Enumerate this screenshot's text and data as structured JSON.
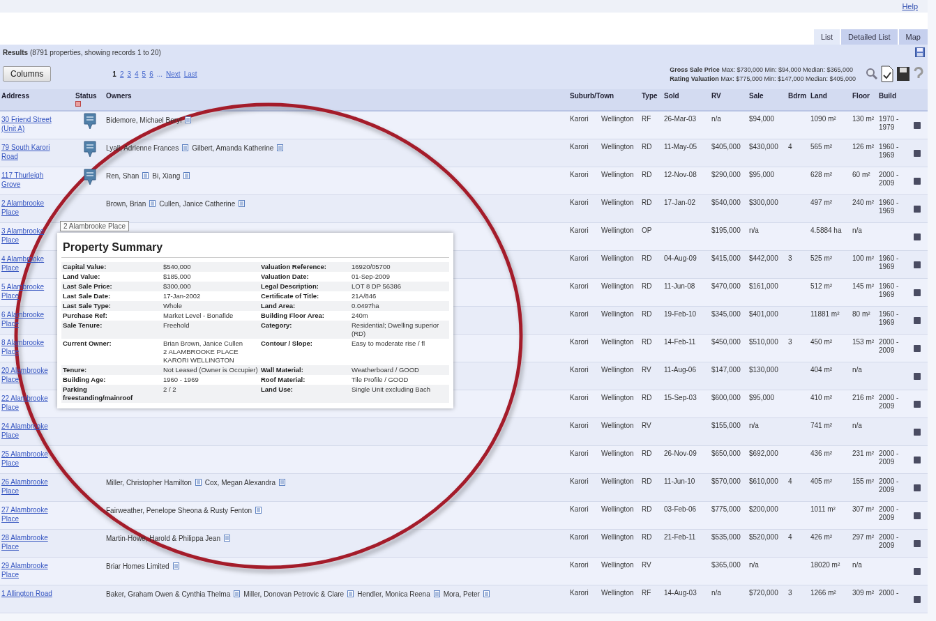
{
  "help_link": "Help",
  "tabs": [
    {
      "label": "List",
      "selected": true
    },
    {
      "label": "Detailed List",
      "selected": false
    },
    {
      "label": "Map",
      "selected": false
    }
  ],
  "results": {
    "title": "Results",
    "summary": "(8791 properties, showing records 1 to 20)"
  },
  "columns_button": "Columns",
  "pagination": {
    "pages": [
      {
        "label": "1",
        "selected": true
      },
      {
        "label": "2",
        "selected": false
      },
      {
        "label": "3",
        "selected": false
      },
      {
        "label": "4",
        "selected": false
      },
      {
        "label": "5",
        "selected": false
      },
      {
        "label": "6",
        "selected": false
      }
    ],
    "ellipsis": "...",
    "next": "Next",
    "last": "Last"
  },
  "stats": [
    {
      "label": "Gross Sale Price",
      "text": "Max: $730,000 Min: $94,000 Median: $365,000"
    },
    {
      "label": "Rating Valuation",
      "text": "Max: $775,000 Min: $147,000 Median: $405,000"
    }
  ],
  "table": {
    "columns": [
      "Address",
      "Status",
      "Owners",
      "Suburb/Town",
      "Type",
      "Sold",
      "RV",
      "Sale",
      "Bdrm",
      "Land",
      "Floor",
      "Build"
    ],
    "rows": [
      {
        "address": "30 Friend Street (Unit A)",
        "status": true,
        "owners": [
          "Bidemore, Michael Beryl"
        ],
        "suburb": "Karori",
        "town": "Wellington",
        "type": "RF",
        "sold": "26-Mar-03",
        "rv": "n/a",
        "sale": "$94,000",
        "land": "1090 m²",
        "floor": "130 m²",
        "build": "1970 - 1979"
      },
      {
        "address": "79 South Karori Road",
        "status": true,
        "owners": [
          "Lyall, Adrienne Frances",
          "Gilbert, Amanda Katherine"
        ],
        "suburb": "Karori",
        "town": "Wellington",
        "type": "RD",
        "sold": "11-May-05",
        "rv": "$405,000",
        "sale": "$430,000",
        "bdrm": "4",
        "land": "565 m²",
        "floor": "126 m²",
        "build": "1960 - 1969"
      },
      {
        "address": "117 Thurleigh Grove",
        "status": true,
        "owners": [
          "Ren, Shan",
          "Bi, Xiang"
        ],
        "suburb": "Karori",
        "town": "Wellington",
        "type": "RD",
        "sold": "12-Nov-08",
        "rv": "$290,000",
        "sale": "$95,000",
        "land": "628 m²",
        "floor": "60 m²",
        "build": "2000 - 2009"
      },
      {
        "address": "2 Alambrooke Place",
        "status": false,
        "owners": [
          "Brown, Brian",
          "Cullen, Janice Catherine"
        ],
        "suburb": "Karori",
        "town": "Wellington",
        "type": "RD",
        "sold": "17-Jan-02",
        "rv": "$540,000",
        "sale": "$300,000",
        "land": "497 m²",
        "floor": "240 m²",
        "build": "1960 - 1969"
      },
      {
        "address": "3 Alambrooke Place",
        "suburb": "Karori",
        "town": "Wellington",
        "type": "OP",
        "rv": "$195,000",
        "sale": "n/a",
        "land": "4.5884 ha",
        "floor": "n/a"
      },
      {
        "address": "4 Alambrooke Place",
        "suburb": "Karori",
        "town": "Wellington",
        "type": "RD",
        "sold": "04-Aug-09",
        "rv": "$415,000",
        "sale": "$442,000",
        "bdrm": "3",
        "land": "525 m²",
        "floor": "100 m²",
        "build": "1960 - 1969"
      },
      {
        "address": "5 Alambrooke Place",
        "suburb": "Karori",
        "town": "Wellington",
        "type": "RD",
        "sold": "11-Jun-08",
        "rv": "$470,000",
        "sale": "$161,000",
        "land": "512 m²",
        "floor": "145 m²",
        "build": "1960 - 1969"
      },
      {
        "address": "6 Alambrooke Place",
        "suburb": "Karori",
        "town": "Wellington",
        "type": "RD",
        "sold": "19-Feb-10",
        "rv": "$345,000",
        "sale": "$401,000",
        "land": "11881 m²",
        "floor": "80 m²",
        "build": "1960 - 1969"
      },
      {
        "address": "8 Alambrooke Place",
        "suburb": "Karori",
        "town": "Wellington",
        "type": "RD",
        "sold": "14-Feb-11",
        "rv": "$450,000",
        "sale": "$510,000",
        "bdrm": "3",
        "land": "450 m²",
        "floor": "153 m²",
        "build": "2000 - 2009"
      },
      {
        "address": "20 Alambrooke Place",
        "suburb": "Karori",
        "town": "Wellington",
        "type": "RV",
        "sold": "11-Aug-06",
        "rv": "$147,000",
        "sale": "$130,000",
        "land": "404 m²",
        "floor": "n/a"
      },
      {
        "address": "22 Alambrooke Place",
        "suburb": "Karori",
        "town": "Wellington",
        "type": "RD",
        "sold": "15-Sep-03",
        "rv": "$600,000",
        "sale": "$95,000",
        "land": "410 m²",
        "floor": "216 m²",
        "build": "2000 - 2009"
      },
      {
        "address": "24 Alambrooke Place",
        "suburb": "Karori",
        "town": "Wellington",
        "type": "RV",
        "rv": "$155,000",
        "sale": "n/a",
        "land": "741 m²",
        "floor": "n/a"
      },
      {
        "address": "25 Alambrooke Place",
        "suburb": "Karori",
        "town": "Wellington",
        "type": "RD",
        "sold": "26-Nov-09",
        "rv": "$650,000",
        "sale": "$692,000",
        "land": "436 m²",
        "floor": "231 m²",
        "build": "2000 - 2009"
      },
      {
        "address": "26 Alambrooke Place",
        "status": false,
        "owners": [
          "Miller, Christopher Hamilton",
          "Cox, Megan Alexandra"
        ],
        "suburb": "Karori",
        "town": "Wellington",
        "type": "RD",
        "sold": "11-Jun-10",
        "rv": "$570,000",
        "sale": "$610,000",
        "bdrm": "4",
        "land": "405 m²",
        "floor": "155 m²",
        "build": "2000 - 2009"
      },
      {
        "address": "27 Alambrooke Place",
        "status": false,
        "owners": [
          "Fairweather, Penelope Sheona & Rusty Fenton"
        ],
        "suburb": "Karori",
        "town": "Wellington",
        "type": "RD",
        "sold": "03-Feb-06",
        "rv": "$775,000",
        "sale": "$200,000",
        "land": "1011 m²",
        "floor": "307 m²",
        "build": "2000 - 2009"
      },
      {
        "address": "28 Alambrooke Place",
        "status": false,
        "owners": [
          "Martin-Howe, Harold & Philippa Jean"
        ],
        "suburb": "Karori",
        "town": "Wellington",
        "type": "RD",
        "sold": "21-Feb-11",
        "rv": "$535,000",
        "sale": "$520,000",
        "bdrm": "4",
        "land": "426 m²",
        "floor": "297 m²",
        "build": "2000 - 2009"
      },
      {
        "address": "29 Alambrooke Place",
        "status": false,
        "owners": [
          "Briar Homes Limited"
        ],
        "suburb": "Karori",
        "town": "Wellington",
        "type": "RV",
        "rv": "$365,000",
        "sale": "n/a",
        "land": "18020 m²",
        "floor": "n/a"
      },
      {
        "address": "1 Allington Road",
        "status": false,
        "owners": [
          "Baker, Graham Owen & Cynthia Thelma",
          "Miller, Donovan Petrovic & Clare",
          "Hendler, Monica Reena",
          "Mora, Peter"
        ],
        "suburb": "Karori",
        "town": "Wellington",
        "type": "RF",
        "sold": "14-Aug-03",
        "rv": "n/a",
        "sale": "$720,000",
        "bdrm": "3",
        "land": "1266 m²",
        "floor": "309 m²",
        "build": "2000 -"
      }
    ]
  },
  "summary_popup": {
    "tooltip": "2 Alambrooke Place",
    "title": "Property Summary",
    "rows": [
      {
        "left": {
          "label": "Capital Value:",
          "value": "$540,000"
        },
        "right": {
          "label": "Valuation Reference:",
          "value": "16920/05700"
        }
      },
      {
        "left": {
          "label": "Land Value:",
          "value": "$185,000"
        },
        "right": {
          "label": "Valuation Date:",
          "value": "01-Sep-2009"
        }
      },
      {
        "left": {
          "label": "Last Sale Price:",
          "value": "$300,000"
        },
        "right": {
          "label": "Legal Description:",
          "value": "LOT 8 DP 56386"
        }
      },
      {
        "left": {
          "label": "Last Sale Date:",
          "value": "17-Jan-2002"
        },
        "right": {
          "label": "Certificate of Title:",
          "value": "21A/846"
        }
      },
      {
        "left": {
          "label": "Last Sale Type:",
          "value": "Whole"
        },
        "right": {
          "label": "Land Area:",
          "value": "0.0497ha"
        }
      },
      {
        "left": {
          "label": "Purchase Ref:",
          "value": "Market Level - Bonafide"
        },
        "right": {
          "label": "Building Floor Area:",
          "value": "240m"
        }
      },
      {
        "left": {
          "label": "Sale Tenure:",
          "value": "Freehold"
        },
        "right": {
          "label": "Category:",
          "value": "Residential; Dwelling superior (RD)"
        }
      },
      {
        "left": {
          "label": "Current Owner:",
          "value": [
            "Brian Brown, Janice Cullen",
            "2 ALAMBROOKE PLACE KARORI WELLINGTON"
          ]
        },
        "right": {
          "label": "Contour / Slope:",
          "value": "Easy to moderate rise / fl"
        }
      },
      {
        "left": {
          "label": "Tenure:",
          "value": "Not Leased (Owner is Occupier)"
        },
        "right": {
          "label": "Wall Material:",
          "value": "Weatherboard / GOOD"
        }
      },
      {
        "left": {
          "label": "Building Age:",
          "value": "1960 - 1969"
        },
        "right": {
          "label": "Roof Material:",
          "value": "Tile Profile / GOOD"
        }
      },
      {
        "left": {
          "label": [
            "Parking",
            "freestanding/mainroof"
          ],
          "value": "2 / 2"
        },
        "right": {
          "label": "Land Use:",
          "value": "Single Unit excluding Bach"
        }
      }
    ]
  }
}
